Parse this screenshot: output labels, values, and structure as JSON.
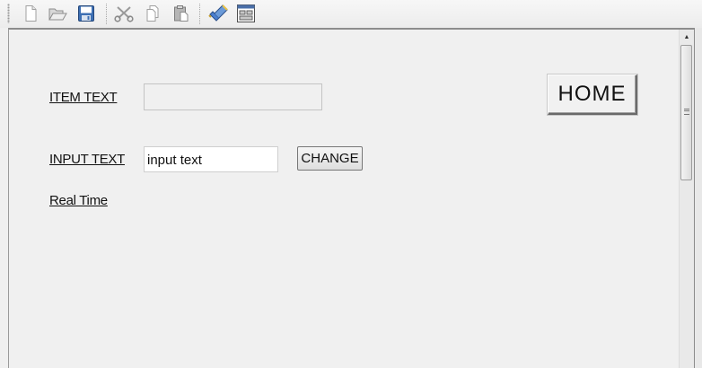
{
  "toolbar": {
    "buttons": [
      {
        "icon": "new-document-icon"
      },
      {
        "icon": "open-folder-icon"
      },
      {
        "icon": "save-disk-icon"
      },
      {
        "icon": "cut-scissors-icon"
      },
      {
        "icon": "copy-icon"
      },
      {
        "icon": "paste-icon"
      },
      {
        "icon": "edit-brush-icon"
      },
      {
        "icon": "window-layout-icon"
      }
    ]
  },
  "form": {
    "item_text_label": "ITEM TEXT",
    "item_text_value": "",
    "input_text_label": "INPUT TEXT",
    "input_text_value": "input text",
    "change_label": "CHANGE",
    "home_label": "HOME",
    "real_time_label": "Real Time"
  },
  "scrollbar": {
    "up_arrow": "▲"
  }
}
